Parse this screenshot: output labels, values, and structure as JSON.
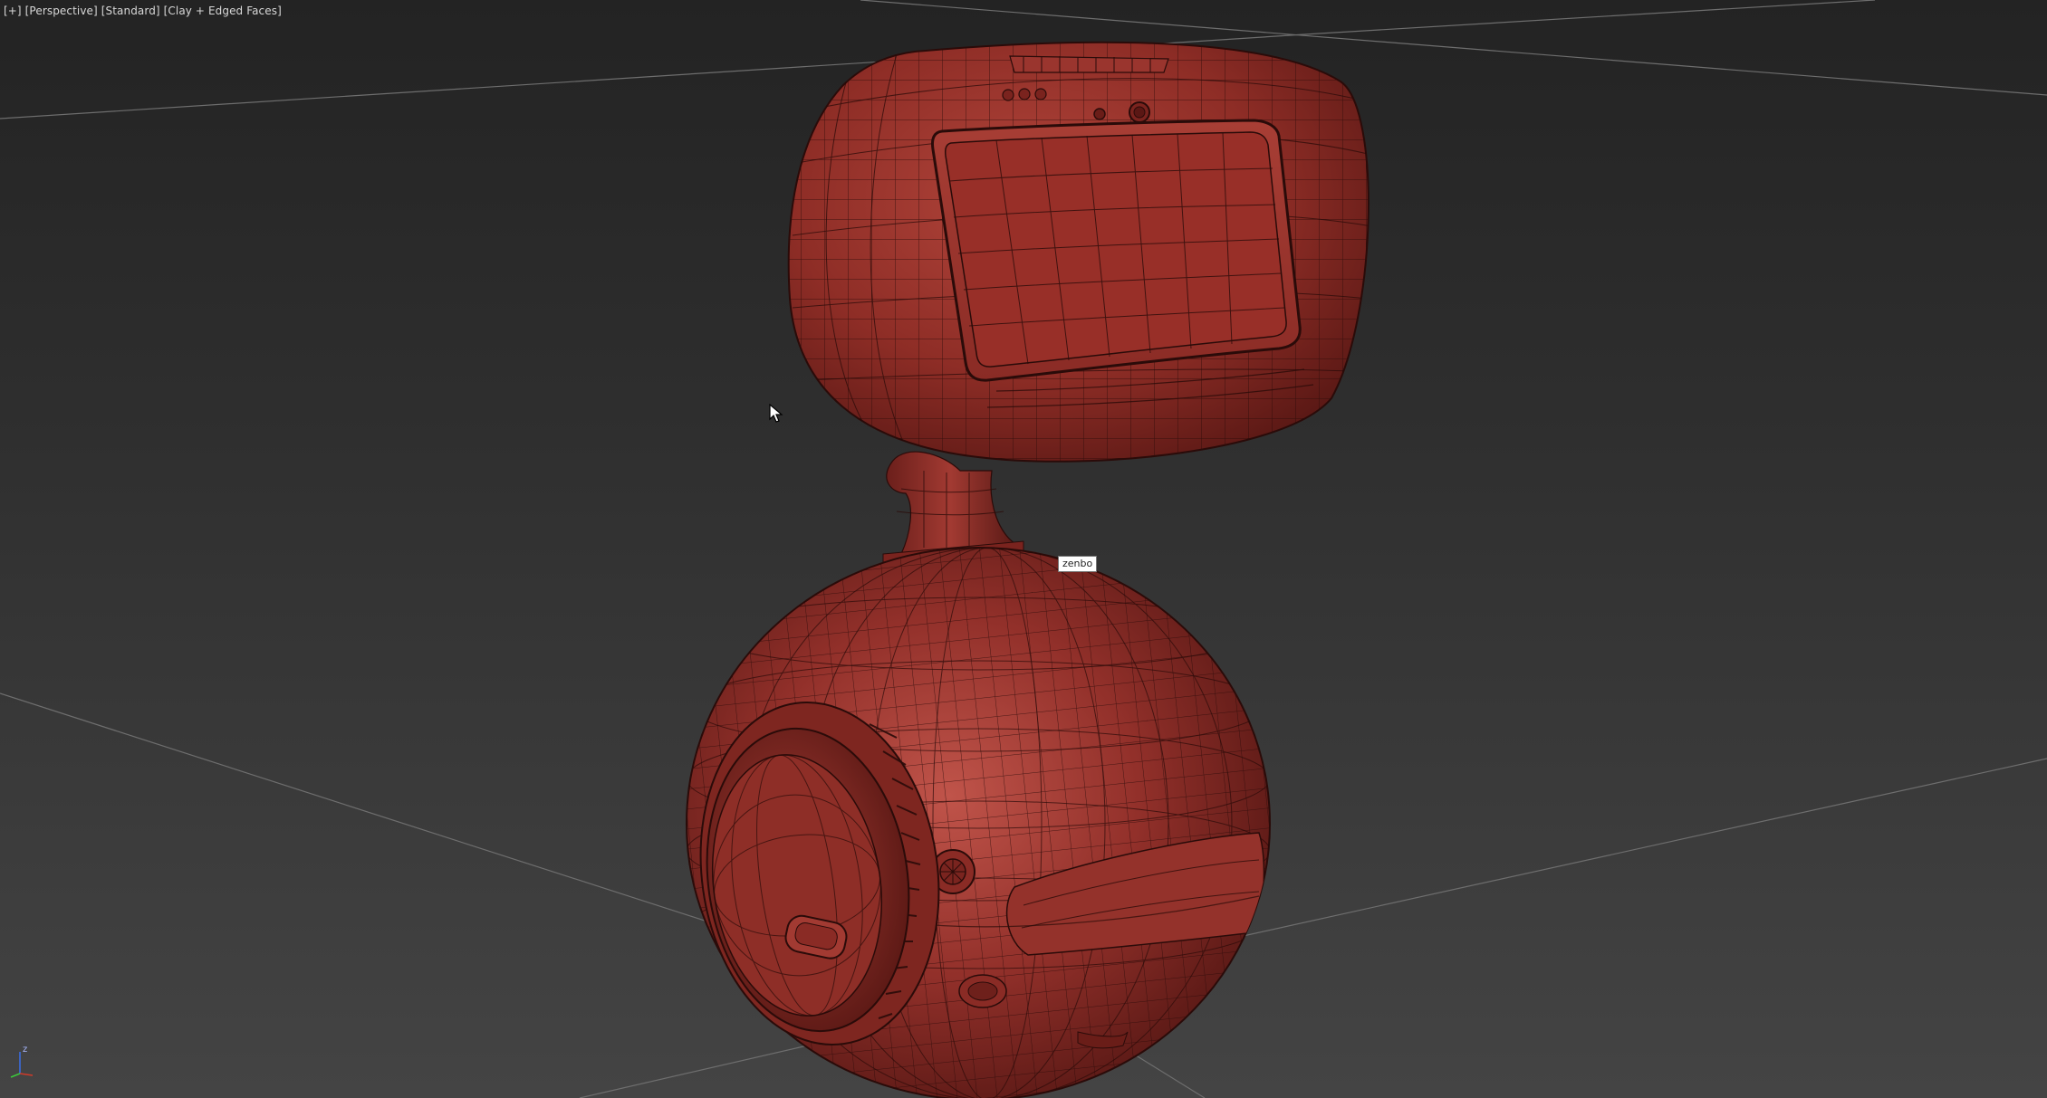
{
  "viewport": {
    "label_parts": [
      "[+]",
      "[Perspective]",
      "[Standard]",
      "[Clay + Edged Faces]"
    ],
    "object_tooltip": "zenbo",
    "axis_gizmo": {
      "z_label": "z"
    },
    "colors": {
      "background": "#2b2b2b",
      "grid_line": "#6e6e6e",
      "model_base": "#8e2d26",
      "model_highlight": "#b84a40",
      "model_shadow": "#4c1210",
      "wire": "#2a0b09"
    }
  }
}
